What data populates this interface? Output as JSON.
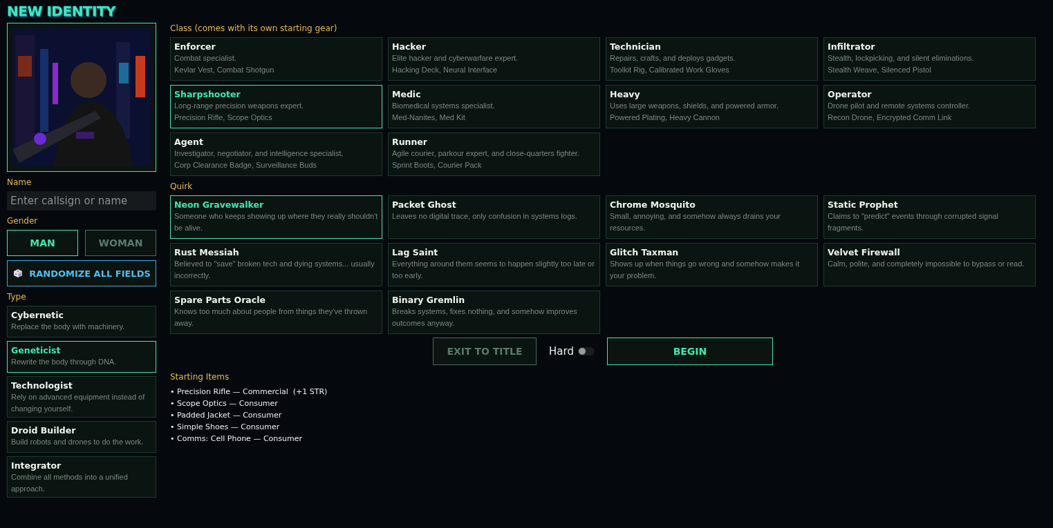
{
  "title": "NEW IDENTITY",
  "name_field": {
    "label": "Name",
    "placeholder": "Enter callsign or name"
  },
  "gender": {
    "label": "Gender",
    "options": [
      {
        "label": "MAN",
        "selected": true
      },
      {
        "label": "WOMAN",
        "selected": false
      }
    ]
  },
  "randomize_button": {
    "label": "RANDOMIZE ALL FIELDS"
  },
  "type": {
    "label": "Type",
    "options": [
      {
        "name": "Cybernetic",
        "desc": "Replace the body with machinery.",
        "selected": false
      },
      {
        "name": "Geneticist",
        "desc": "Rewrite the body through DNA.",
        "selected": true
      },
      {
        "name": "Technologist",
        "desc": "Rely on advanced equipment instead of changing yourself.",
        "selected": false
      },
      {
        "name": "Droid Builder",
        "desc": "Build robots and drones to do the work.",
        "selected": false
      },
      {
        "name": "Integrator",
        "desc": "Combine all methods into a unified approach.",
        "selected": false
      }
    ]
  },
  "class": {
    "label": "Class (comes with its own starting gear)",
    "options": [
      {
        "name": "Enforcer",
        "desc": "Combat specialist.",
        "gear": "Kevlar Vest, Combat Shotgun",
        "selected": false
      },
      {
        "name": "Hacker",
        "desc": "Elite hacker and cyberwarfare expert.",
        "gear": "Hacking Deck, Neural Interface",
        "selected": false
      },
      {
        "name": "Technician",
        "desc": "Repairs, crafts, and deploys gadgets.",
        "gear": "Toolkit Rig, Calibrated Work Gloves",
        "selected": false
      },
      {
        "name": "Infiltrator",
        "desc": "Stealth, lockpicking, and silent eliminations.",
        "gear": "Stealth Weave, Silenced Pistol",
        "selected": false
      },
      {
        "name": "Sharpshooter",
        "desc": "Long-range precision weapons expert.",
        "gear": "Precision Rifle, Scope Optics",
        "selected": true
      },
      {
        "name": "Medic",
        "desc": "Biomedical systems specialist.",
        "gear": "Med-Nanites, Med Kit",
        "selected": false
      },
      {
        "name": "Heavy",
        "desc": "Uses large weapons, shields, and powered armor.",
        "gear": "Powered Plating, Heavy Cannon",
        "selected": false
      },
      {
        "name": "Operator",
        "desc": "Drone pilot and remote systems controller.",
        "gear": "Recon Drone, Encrypted Comm Link",
        "selected": false
      },
      {
        "name": "Agent",
        "desc": "Investigator, negotiator, and intelligence specialist.",
        "gear": "Corp Clearance Badge, Surveillance Buds",
        "selected": false
      },
      {
        "name": "Runner",
        "desc": "Agile courier, parkour expert, and close-quarters fighter.",
        "gear": "Sprint Boots, Courier Pack",
        "selected": false
      }
    ]
  },
  "quirk": {
    "label": "Quirk",
    "options": [
      {
        "name": "Neon Gravewalker",
        "desc": "Someone who keeps showing up where they really shouldn't be alive.",
        "selected": true
      },
      {
        "name": "Packet Ghost",
        "desc": "Leaves no digital trace, only confusion in systems logs.",
        "selected": false
      },
      {
        "name": "Chrome Mosquito",
        "desc": "Small, annoying, and somehow always drains your resources.",
        "selected": false
      },
      {
        "name": "Static Prophet",
        "desc": "Claims to \"predict\" events through corrupted signal fragments.",
        "selected": false
      },
      {
        "name": "Rust Messiah",
        "desc": "Believed to \"save\" broken tech and dying systems... usually incorrectly.",
        "selected": false
      },
      {
        "name": "Lag Saint",
        "desc": "Everything around them seems to happen slightly too late or too early.",
        "selected": false
      },
      {
        "name": "Glitch Taxman",
        "desc": "Shows up when things go wrong and somehow makes it your problem.",
        "selected": false
      },
      {
        "name": "Velvet Firewall",
        "desc": "Calm, polite, and completely impossible to bypass or read.",
        "selected": false
      },
      {
        "name": "Spare Parts Oracle",
        "desc": "Knows too much about people from things they've thrown away.",
        "selected": false
      },
      {
        "name": "Binary Gremlin",
        "desc": "Breaks systems, fixes nothing, and somehow improves outcomes anyway.",
        "selected": false
      }
    ]
  },
  "actions": {
    "exit_label": "EXIT TO TITLE",
    "hard": {
      "label": "Hard",
      "on": false
    },
    "begin_label": "BEGIN"
  },
  "starting_items": {
    "label": "Starting Items",
    "items": [
      "• Precision Rifle — Commercial  (+1 STR)",
      "• Scope Optics — Consumer",
      "• Padded Jacket — Consumer",
      "• Simple Shoes — Consumer",
      "• Comms: Cell Phone — Consumer"
    ]
  }
}
